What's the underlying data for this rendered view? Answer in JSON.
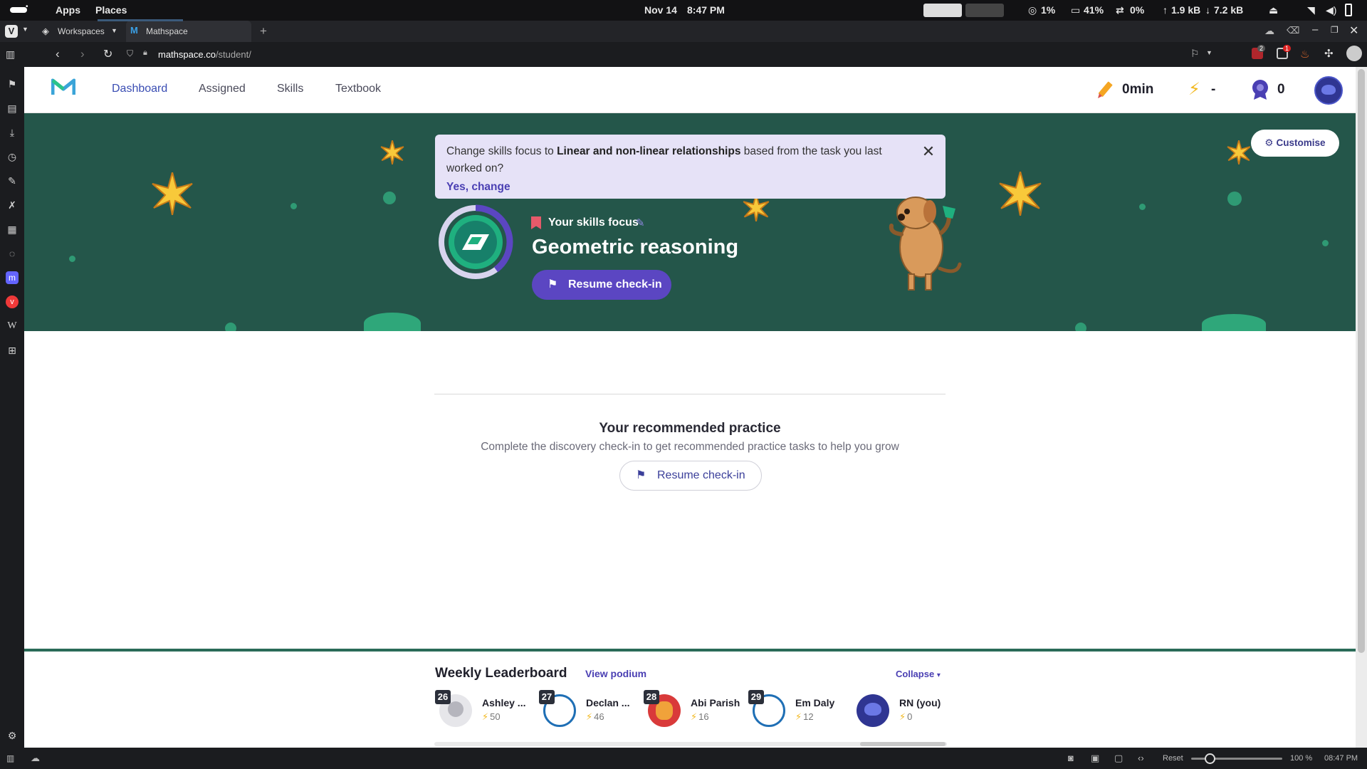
{
  "system_bar": {
    "apps": "Apps",
    "places": "Places",
    "date": "Nov 14",
    "time": "8:47 PM",
    "cpu": "1%",
    "battery": "41%",
    "swap": "0%",
    "upload": "1.9 kB",
    "download": "7.2 kB"
  },
  "browser": {
    "workspaces_label": "Workspaces",
    "tab_title": "Mathspace",
    "url_host": "mathspace.co",
    "url_path": "/student/",
    "ext_badge_1": "2",
    "ext_badge_2": "1"
  },
  "status_bar": {
    "reset_label": "Reset",
    "zoom": "100 %",
    "clock": "08:47 PM",
    "zoom_slider_level": 0.15
  },
  "app_header": {
    "nav": [
      {
        "label": "Dashboard",
        "active": true
      },
      {
        "label": "Assigned",
        "active": false
      },
      {
        "label": "Skills",
        "active": false
      },
      {
        "label": "Textbook",
        "active": false
      }
    ],
    "time_spent": "0min",
    "streak": "-",
    "badges": "0"
  },
  "hero": {
    "customise_label": "Customise",
    "notice": {
      "prefix": "Change skills focus to ",
      "topic": "Linear and non-linear relationships",
      "suffix": " based from the task you last worked on?",
      "action": "Yes, change"
    },
    "focus_label": "Your skills focus",
    "focus_title": "Geometric reasoning",
    "resume_label": "Resume check-in",
    "colors": {
      "background": "#24564a",
      "button": "#5b46c2",
      "ring": "#5b46c2",
      "accent": "#1fb07f"
    }
  },
  "recommended": {
    "title": "Your recommended practice",
    "subtitle": "Complete the discovery check-in to get recommended practice tasks to help you grow",
    "resume_label": "Resume check-in"
  },
  "leaderboard": {
    "title": "Weekly Leaderboard",
    "view_podium": "View podium",
    "collapse": "Collapse",
    "entries": [
      {
        "rank": "26",
        "name": "Ashley ...",
        "score": "50",
        "avatar_color": "#e6e6ea"
      },
      {
        "rank": "27",
        "name": "Declan ...",
        "score": "46",
        "avatar_color": "#ffffff"
      },
      {
        "rank": "28",
        "name": "Abi Parish",
        "score": "16",
        "avatar_color": "#d93a3a"
      },
      {
        "rank": "29",
        "name": "Em Daly",
        "score": "12",
        "avatar_color": "#ffffff"
      },
      {
        "rank": "",
        "name": "RN (you)",
        "score": "0",
        "avatar_color": "#2f3592"
      }
    ]
  }
}
